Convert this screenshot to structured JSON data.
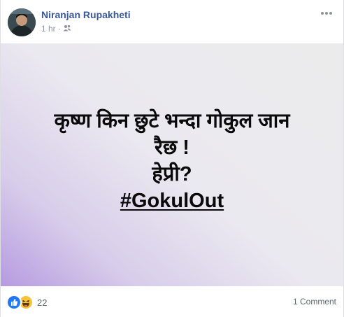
{
  "post": {
    "author": "Niranjan Rupakheti",
    "time": "1 hr",
    "privacy_icon": "friends-icon",
    "more_icon": "more-options-icon"
  },
  "card": {
    "line1": "कृष्ण किन छुटे भन्दा गोकुल जान",
    "line2": "रैछ !",
    "line3": "हेप्री?",
    "hashtag": "#GokulOut",
    "gradient_colors": [
      "#b69be0",
      "#ebe9f0",
      "#ebebeb"
    ]
  },
  "footer": {
    "reaction_icons": [
      "like-icon",
      "haha-icon"
    ],
    "reaction_count": "22",
    "comments": "1 Comment"
  },
  "colors": {
    "author_link": "#385898",
    "meta_text": "#90949c",
    "like_blue": "#2078f4",
    "haha_yellow": "#f7c33b"
  }
}
